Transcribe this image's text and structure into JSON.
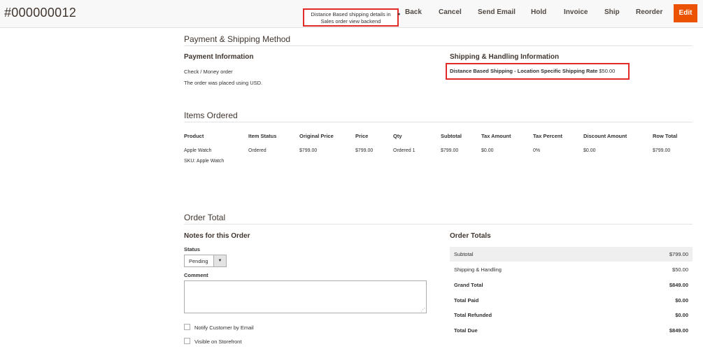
{
  "header": {
    "order_id": "#000000012",
    "buttons": {
      "back": "Back",
      "cancel": "Cancel",
      "send_email": "Send Email",
      "hold": "Hold",
      "invoice": "Invoice",
      "ship": "Ship",
      "reorder": "Reorder",
      "edit": "Edit"
    },
    "edit_color": "#eb5202"
  },
  "callout": {
    "line1": "Distance Based shipping details in",
    "line2": "Sales order view backend",
    "border_color": "#e02b27"
  },
  "payment_shipping": {
    "title": "Payment & Shipping Method",
    "payment": {
      "title": "Payment Information",
      "method": "Check / Money order",
      "currency_note": "The order was placed using USD."
    },
    "shipping": {
      "title": "Shipping & Handling Information",
      "method": "Distance Based Shipping - Location Specific Shipping Rate",
      "amount": "$50.00"
    }
  },
  "items": {
    "title": "Items Ordered",
    "columns": [
      "Product",
      "Item Status",
      "Original Price",
      "Price",
      "Qty",
      "Subtotal",
      "Tax Amount",
      "Tax Percent",
      "Discount Amount",
      "Row Total"
    ],
    "rows": [
      {
        "product": "Apple Watch",
        "sku": "SKU: Apple Watch",
        "status": "Ordered",
        "original_price": "$799.00",
        "price": "$799.00",
        "qty": "Ordered 1",
        "subtotal": "$799.00",
        "tax_amount": "$0.00",
        "tax_percent": "0%",
        "discount": "$0.00",
        "row_total": "$799.00"
      }
    ]
  },
  "order_total": {
    "title": "Order Total",
    "notes": {
      "title": "Notes for this Order",
      "status_label": "Status",
      "status_value": "Pending",
      "comment_label": "Comment",
      "notify_label": "Notify Customer by Email",
      "visible_label": "Visible on Storefront"
    },
    "totals": {
      "title": "Order Totals",
      "rows": [
        {
          "label": "Subtotal",
          "value": "$799.00"
        },
        {
          "label": "Shipping & Handling",
          "value": "$50.00"
        },
        {
          "label": "Grand Total",
          "value": "$849.00"
        },
        {
          "label": "Total Paid",
          "value": "$0.00"
        },
        {
          "label": "Total Refunded",
          "value": "$0.00"
        },
        {
          "label": "Total Due",
          "value": "$849.00"
        }
      ]
    }
  }
}
